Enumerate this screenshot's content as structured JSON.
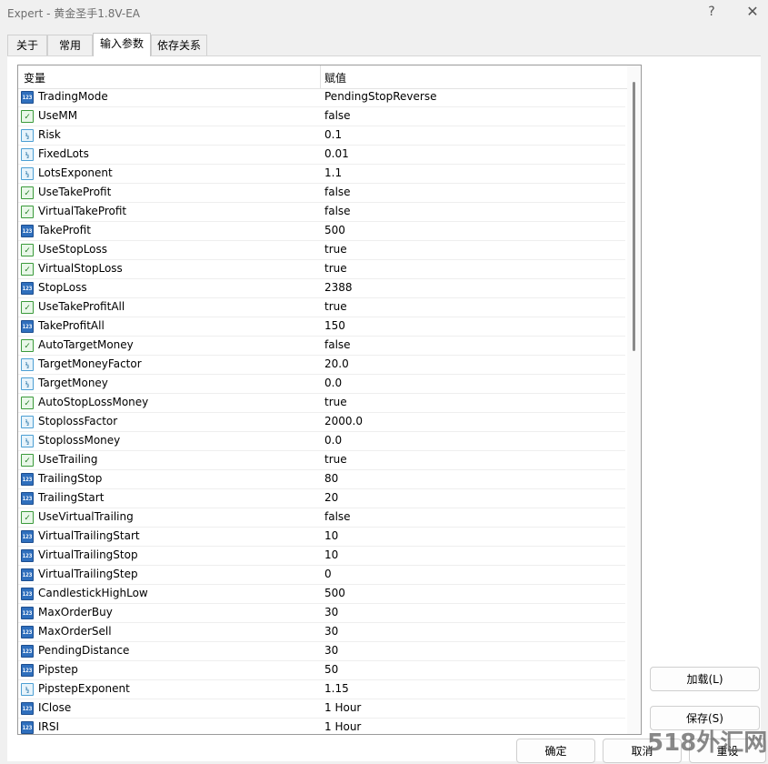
{
  "window": {
    "title": "Expert - 黄金圣手1.8V-EA",
    "help_glyph": "?",
    "close_glyph": "✕"
  },
  "tabs": [
    {
      "label": "关于"
    },
    {
      "label": "常用"
    },
    {
      "label": "输入参数"
    },
    {
      "label": "依存关系"
    }
  ],
  "active_tab": "输入参数",
  "grid": {
    "headers": {
      "variable": "变量",
      "value": "赋值"
    },
    "rows": [
      {
        "type": "int",
        "name": "TradingMode",
        "value": "PendingStopReverse"
      },
      {
        "type": "bool",
        "name": "UseMM",
        "value": "false"
      },
      {
        "type": "double",
        "name": "Risk",
        "value": "0.1"
      },
      {
        "type": "double",
        "name": "FixedLots",
        "value": "0.01"
      },
      {
        "type": "double",
        "name": "LotsExponent",
        "value": "1.1"
      },
      {
        "type": "bool",
        "name": "UseTakeProfit",
        "value": "false"
      },
      {
        "type": "bool",
        "name": "VirtualTakeProfit",
        "value": "false"
      },
      {
        "type": "int",
        "name": "TakeProfit",
        "value": "500"
      },
      {
        "type": "bool",
        "name": "UseStopLoss",
        "value": "true"
      },
      {
        "type": "bool",
        "name": "VirtualStopLoss",
        "value": "true"
      },
      {
        "type": "int",
        "name": "StopLoss",
        "value": "2388"
      },
      {
        "type": "bool",
        "name": "UseTakeProfitAll",
        "value": "true"
      },
      {
        "type": "int",
        "name": "TakeProfitAll",
        "value": "150"
      },
      {
        "type": "bool",
        "name": "AutoTargetMoney",
        "value": "false"
      },
      {
        "type": "double",
        "name": "TargetMoneyFactor",
        "value": "20.0"
      },
      {
        "type": "double",
        "name": "TargetMoney",
        "value": "0.0"
      },
      {
        "type": "bool",
        "name": "AutoStopLossMoney",
        "value": "true"
      },
      {
        "type": "double",
        "name": "StoplossFactor",
        "value": "2000.0"
      },
      {
        "type": "double",
        "name": "StoplossMoney",
        "value": "0.0"
      },
      {
        "type": "bool",
        "name": "UseTrailing",
        "value": "true"
      },
      {
        "type": "int",
        "name": "TrailingStop",
        "value": "80"
      },
      {
        "type": "int",
        "name": "TrailingStart",
        "value": "20"
      },
      {
        "type": "bool",
        "name": "UseVirtualTrailing",
        "value": "false"
      },
      {
        "type": "int",
        "name": "VirtualTrailingStart",
        "value": "10"
      },
      {
        "type": "int",
        "name": "VirtualTrailingStop",
        "value": "10"
      },
      {
        "type": "int",
        "name": "VirtualTrailingStep",
        "value": "0"
      },
      {
        "type": "int",
        "name": "CandlestickHighLow",
        "value": "500"
      },
      {
        "type": "int",
        "name": "MaxOrderBuy",
        "value": "30"
      },
      {
        "type": "int",
        "name": "MaxOrderSell",
        "value": "30"
      },
      {
        "type": "int",
        "name": "PendingDistance",
        "value": "30"
      },
      {
        "type": "int",
        "name": "Pipstep",
        "value": "50"
      },
      {
        "type": "double",
        "name": "PipstepExponent",
        "value": "1.15"
      },
      {
        "type": "int",
        "name": "IClose",
        "value": "1 Hour"
      },
      {
        "type": "int",
        "name": "IRSI",
        "value": "1 Hour"
      }
    ]
  },
  "type_icons": {
    "int": "123",
    "bool": "✓",
    "double": "½"
  },
  "buttons": {
    "load": "加载(L)",
    "save": "保存(S)",
    "ok": "确定",
    "cancel": "取消",
    "reset": "重设"
  },
  "watermark": "518外汇网"
}
